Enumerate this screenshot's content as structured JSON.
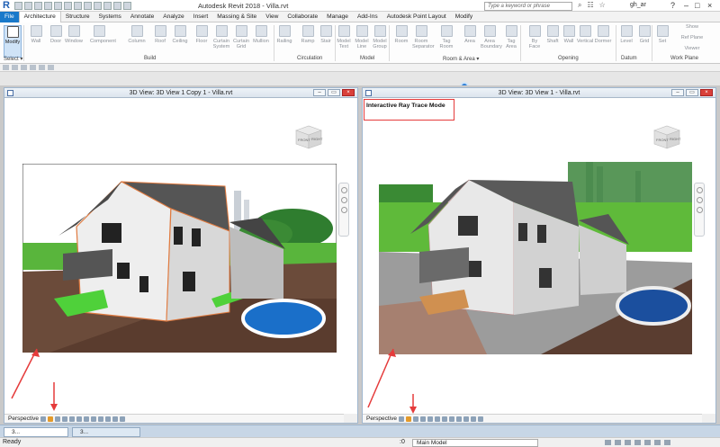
{
  "title_bar": {
    "app_logo": "R",
    "app_title": "Autodesk Revit 2018 -    Villa.rvt",
    "search_placeholder": "Type a keyword or phrase",
    "user": "gh_ar"
  },
  "menu_tabs": [
    "File",
    "Architecture",
    "Structure",
    "Systems",
    "Annotate",
    "Analyze",
    "Insert",
    "Massing & Site",
    "View",
    "Collaborate",
    "Manage",
    "Add-Ins",
    "Autodesk Point Layout",
    "Modify"
  ],
  "ribbon": {
    "buttons": [
      "Modify",
      "Wall",
      "Door",
      "Window",
      "Component",
      "Column",
      "Roof",
      "Ceiling",
      "Floor",
      "Curtain System",
      "Curtain Grid",
      "Mullion",
      "Railing",
      "Ramp",
      "Stair",
      "Model Text",
      "Model Line",
      "Model Group",
      "Room",
      "Room Separator",
      "Tag Room",
      "Area",
      "Area Boundary",
      "Tag Area",
      "By Face",
      "Shaft",
      "Wall",
      "Vertical",
      "Dormer",
      "Level",
      "Grid",
      "Set",
      "Show",
      "Ref Plane",
      "Viewer"
    ],
    "panels": [
      "Select ▾",
      "Build",
      "Circulation",
      "Model",
      "Room & Area ▾",
      "Opening",
      "Datum",
      "Work Plane"
    ]
  },
  "views": [
    {
      "title": "3D View: 3D View 1 Copy 1 - Villa.rvt",
      "visual_style": "Perspective",
      "cube_faces": [
        "FRONT",
        "RIGHT"
      ]
    },
    {
      "title": "3D View: 3D View 1 - Villa.rvt",
      "visual_style": "Perspective",
      "cube_faces": [
        "FRONT",
        "RIGHT"
      ],
      "highlight": "Interactive Ray Trace Mode"
    }
  ],
  "bottom_tabs": [
    {
      "label": "3..."
    },
    {
      "label": "3..."
    }
  ],
  "status": {
    "text": "Ready",
    "model": "Main Model",
    "zoom": ":0"
  },
  "colors": {
    "accent": "#1979ca",
    "annotation": "#e53b3b",
    "sky": "#ffffff",
    "grass": "#4fb03a"
  }
}
